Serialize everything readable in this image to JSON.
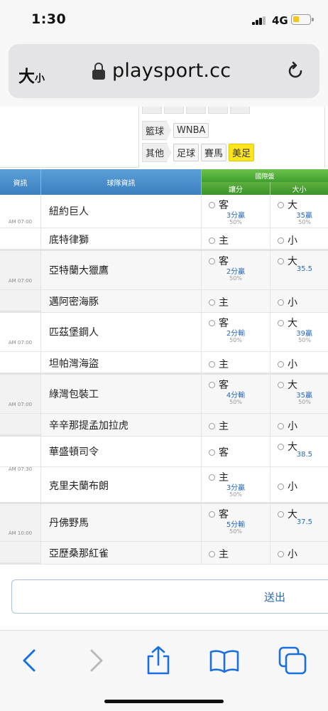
{
  "status": {
    "time": "1:30",
    "network": "4G"
  },
  "browser": {
    "text_size_label": "大",
    "text_size_small": "小",
    "domain": "playsport.cc"
  },
  "filters": {
    "row1_category": "籃球",
    "row1_tags": [
      "WNBA"
    ],
    "row2_category": "其他",
    "row2_tags": [
      "足球",
      "賽馬",
      "美足"
    ],
    "active_tag": "美足"
  },
  "table": {
    "headers": {
      "info": "資訊",
      "team": "球隊資訊",
      "group": "國際盤",
      "spread": "讓分",
      "total": "大小"
    },
    "games": [
      {
        "time": "AM 07:00",
        "away": {
          "team": "紐約巨人",
          "spread_opt": "客",
          "spread_line": "3分贏",
          "spread_pct": "50%",
          "total_opt": "大",
          "total_line": "35贏",
          "total_pct": "50%"
        },
        "home": {
          "team": "底特律獅",
          "spread_opt": "主",
          "total_opt": "小"
        }
      },
      {
        "time": "AM 07:00",
        "away": {
          "team": "亞特蘭大獵鷹",
          "spread_opt": "客",
          "spread_line": "2分贏",
          "spread_pct": "50%",
          "total_opt": "大",
          "total_line": "35.5",
          "total_pct": ""
        },
        "home": {
          "team": "邁阿密海豚",
          "spread_opt": "主",
          "total_opt": "小"
        }
      },
      {
        "time": "AM 07:00",
        "away": {
          "team": "匹茲堡鋼人",
          "spread_opt": "客",
          "spread_line": "2分輸",
          "spread_pct": "50%",
          "total_opt": "大",
          "total_line": "39贏",
          "total_pct": "50%"
        },
        "home": {
          "team": "坦帕灣海盜",
          "spread_opt": "主",
          "total_opt": "小"
        }
      },
      {
        "time": "AM 07:00",
        "away": {
          "team": "綠灣包裝工",
          "spread_opt": "客",
          "spread_line": "4分輸",
          "spread_pct": "50%",
          "total_opt": "大",
          "total_line": "35贏",
          "total_pct": "50%"
        },
        "home": {
          "team": "辛辛那提孟加拉虎",
          "spread_opt": "主",
          "total_opt": "小"
        }
      },
      {
        "time": "AM 07:30",
        "away": {
          "team": "華盛頓司令",
          "spread_opt": "客",
          "total_opt": "大",
          "total_line": "38.5",
          "total_pct": ""
        },
        "home": {
          "team": "克里夫蘭布朗",
          "spread_opt": "主",
          "spread_line": "3分贏",
          "spread_pct": "50%",
          "total_opt": "小"
        }
      },
      {
        "time": "AM 10:00",
        "away": {
          "team": "丹佛野馬",
          "spread_opt": "客",
          "spread_line": "5分輸",
          "spread_pct": "50%",
          "total_opt": "大",
          "total_line": "37.5",
          "total_pct": ""
        },
        "home": {
          "team": "亞歷桑那紅雀",
          "spread_opt": "主",
          "total_opt": "小"
        }
      }
    ]
  },
  "submit_label": "送出",
  "colors": {
    "header_blue": "#4a8fcf",
    "header_green": "#4fae36",
    "link_blue": "#2a6ab5",
    "active_tag": "#ffe51c"
  }
}
